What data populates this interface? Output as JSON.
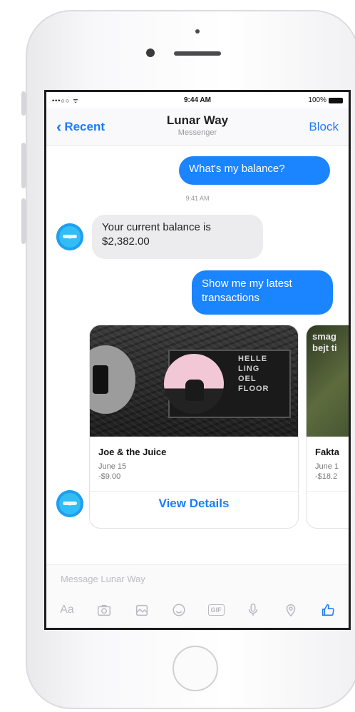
{
  "status": {
    "signal": "•••○○ ᯤ",
    "time": "9:44 AM",
    "battery": "100%"
  },
  "header": {
    "back_label": "Recent",
    "title": "Lunar Way",
    "subtitle": "Messenger",
    "block_label": "Block"
  },
  "chat": {
    "msg1": "What's my balance?",
    "timestamp": "9:41 AM",
    "reply1": "Your current balance is $2,382.00",
    "msg2": "Show me my latest transactions"
  },
  "cards": [
    {
      "name": "Joe & the Juice",
      "date": "June 15",
      "amount": "-$9.00",
      "action": "View Details",
      "sign_text": "HELLE\nLING\nOEL\nFLOOR"
    },
    {
      "name": "Fakta",
      "date": "June 1",
      "amount": "-$18.2",
      "overlay_text": "smag\nbejt ti"
    }
  ],
  "composer": {
    "placeholder": "Message Lunar Way"
  },
  "toolbar_icons": [
    "text-aa-icon",
    "camera-icon",
    "gallery-icon",
    "emoji-icon",
    "gif-icon",
    "microphone-icon",
    "location-icon",
    "thumbs-up-icon"
  ],
  "toolbar_labels": {
    "aa": "Aa",
    "gif": "GIF"
  },
  "colors": {
    "accent": "#1b7cf7",
    "bubble_out": "#1b84ff",
    "bubble_in": "#ececef"
  }
}
